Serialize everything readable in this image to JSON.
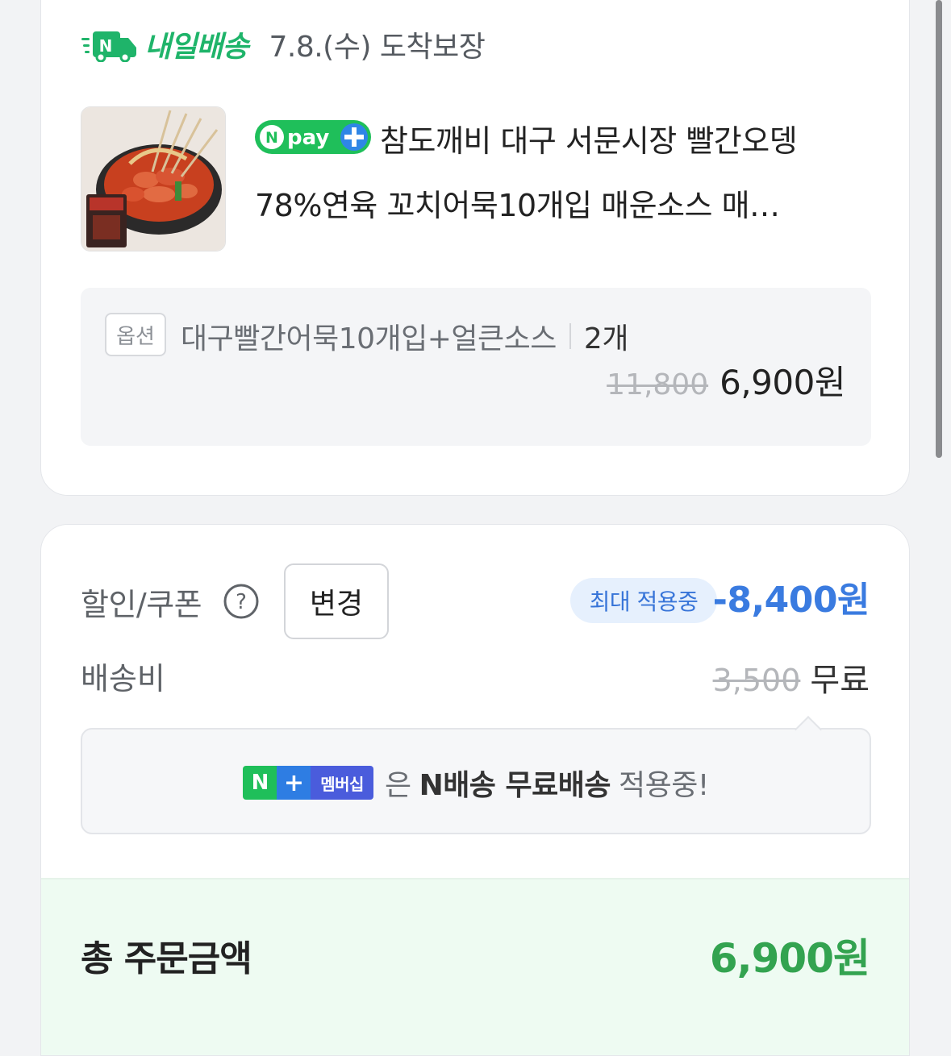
{
  "delivery": {
    "brand": "내일배송",
    "arrival": "7.8.(수) 도착보장"
  },
  "product": {
    "badge": "Npay+",
    "title_line1": "참도깨비 대구 서문시장 빨간오뎅",
    "title_line2": "78%연육 꼬치어묵10개입 매운소스 매…"
  },
  "option": {
    "tag": "옵션",
    "name": "대구빨간어묵10개입+얼큰소스",
    "quantity": "2개",
    "original_price": "11,800",
    "price": "6,900원"
  },
  "discount": {
    "label": "할인/쿠폰",
    "change_button": "변경",
    "applied_badge": "최대 적용중",
    "amount": "-8,400원"
  },
  "shipping": {
    "label": "배송비",
    "original_price": "3,500",
    "price": "무료"
  },
  "membership": {
    "badge_n": "N",
    "badge_plus": "+",
    "badge_label": "멤버십",
    "prefix": "은",
    "highlight": "N배송 무료배송",
    "suffix": "적용중!"
  },
  "total": {
    "label": "총 주문금액",
    "amount": "6,900원"
  },
  "colors": {
    "brand_green": "#1fb46a",
    "discount_blue": "#3a7be0",
    "total_green": "#33a350",
    "total_background": "#eefbf2"
  }
}
